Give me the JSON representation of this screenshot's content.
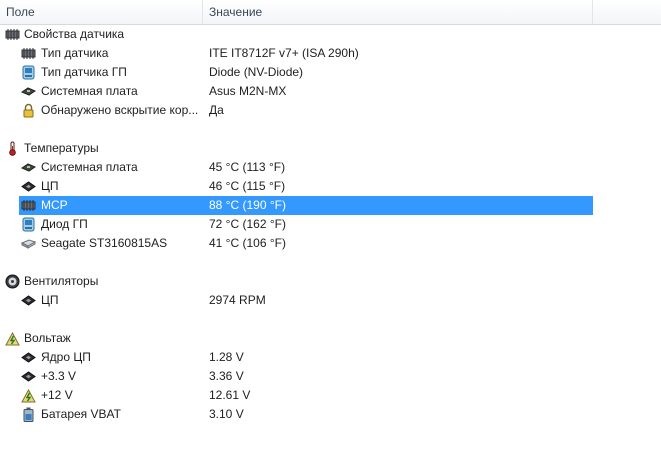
{
  "columns": {
    "field": "Поле",
    "value": "Значение"
  },
  "sections": {
    "sensor_props": {
      "title": "Свойства датчика",
      "items": [
        {
          "label": "Тип датчика",
          "value": "ITE IT8712F v7+  (ISA 290h)",
          "icon": "chip-icon"
        },
        {
          "label": "Тип датчика ГП",
          "value": "Diode  (NV-Diode)",
          "icon": "gpu-icon"
        },
        {
          "label": "Системная плата",
          "value": "Asus M2N-MX",
          "icon": "motherboard-icon"
        },
        {
          "label": "Обнаружено вскрытие кор...",
          "value": "Да",
          "icon": "lock-icon"
        }
      ]
    },
    "temperatures": {
      "title": "Температуры",
      "items": [
        {
          "label": "Системная плата",
          "value": "45 °C  (113 °F)",
          "icon": "motherboard-icon"
        },
        {
          "label": "ЦП",
          "value": "46 °C  (115 °F)",
          "icon": "cpu-icon"
        },
        {
          "label": "MCP",
          "value": "88 °C  (190 °F)",
          "icon": "chip-icon"
        },
        {
          "label": "Диод ГП",
          "value": "72 °C  (162 °F)",
          "icon": "gpu-icon"
        },
        {
          "label": "Seagate ST3160815AS",
          "value": "41 °C  (106 °F)",
          "icon": "harddisk-icon"
        }
      ]
    },
    "fans": {
      "title": "Вентиляторы",
      "items": [
        {
          "label": "ЦП",
          "value": "2974 RPM",
          "icon": "cpu-icon"
        }
      ]
    },
    "voltage": {
      "title": "Вольтаж",
      "items": [
        {
          "label": "Ядро ЦП",
          "value": "1.28 V",
          "icon": "cpu-icon"
        },
        {
          "label": "+3.3 V",
          "value": "3.36 V",
          "icon": "cpu-icon"
        },
        {
          "label": "+12 V",
          "value": "12.61 V",
          "icon": "voltage-icon"
        },
        {
          "label": "Батарея VBAT",
          "value": "3.10 V",
          "icon": "battery-icon"
        }
      ]
    }
  },
  "selected_row": "MCP",
  "colors": {
    "selection": "#3399ff",
    "header_text": "#3b4656",
    "text": "#1e1e1e"
  }
}
